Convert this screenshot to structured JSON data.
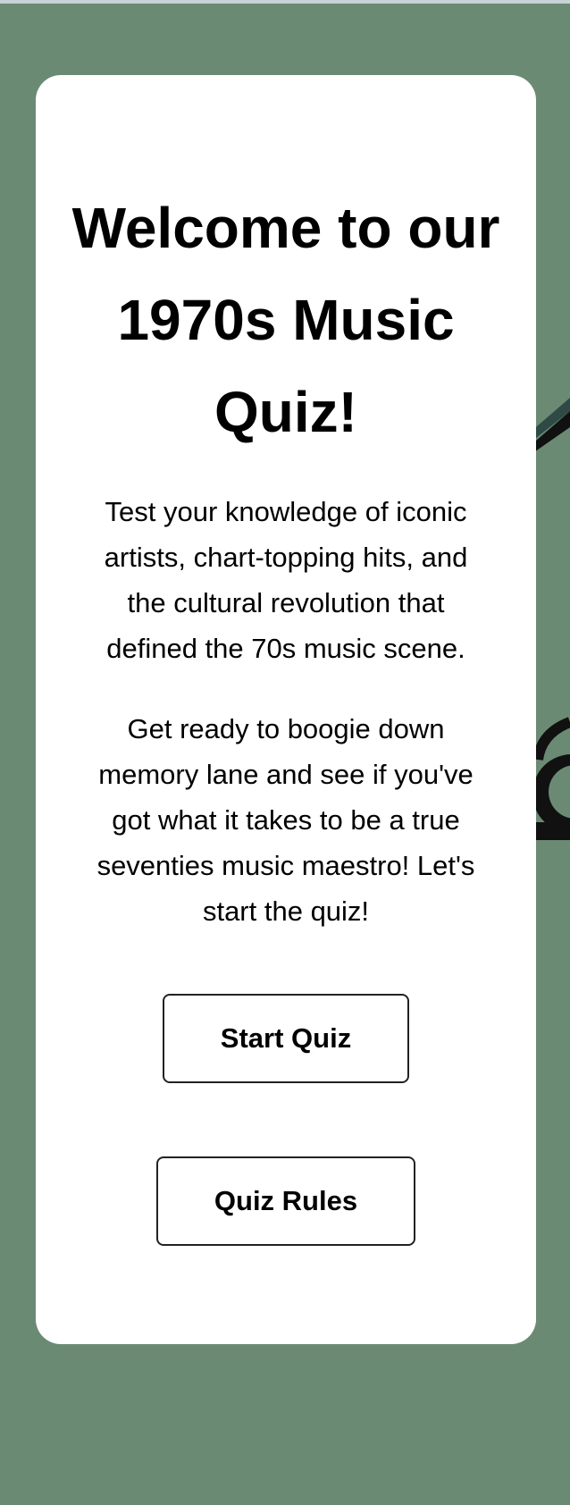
{
  "page": {
    "background_color": "#6b8a73",
    "card_color": "#ffffff"
  },
  "welcome": {
    "title": "Welcome to our 1970s Music Quiz!",
    "paragraph_1": "Test your knowledge of iconic artists, chart-topping hits, and the cultural revolution that defined the 70s music scene.",
    "paragraph_2": "Get ready to boogie down memory lane and see if you've got what it takes to be a true seventies music maestro! Let's start the quiz!"
  },
  "buttons": {
    "start_label": "Start Quiz",
    "rules_label": "Quiz Rules"
  }
}
